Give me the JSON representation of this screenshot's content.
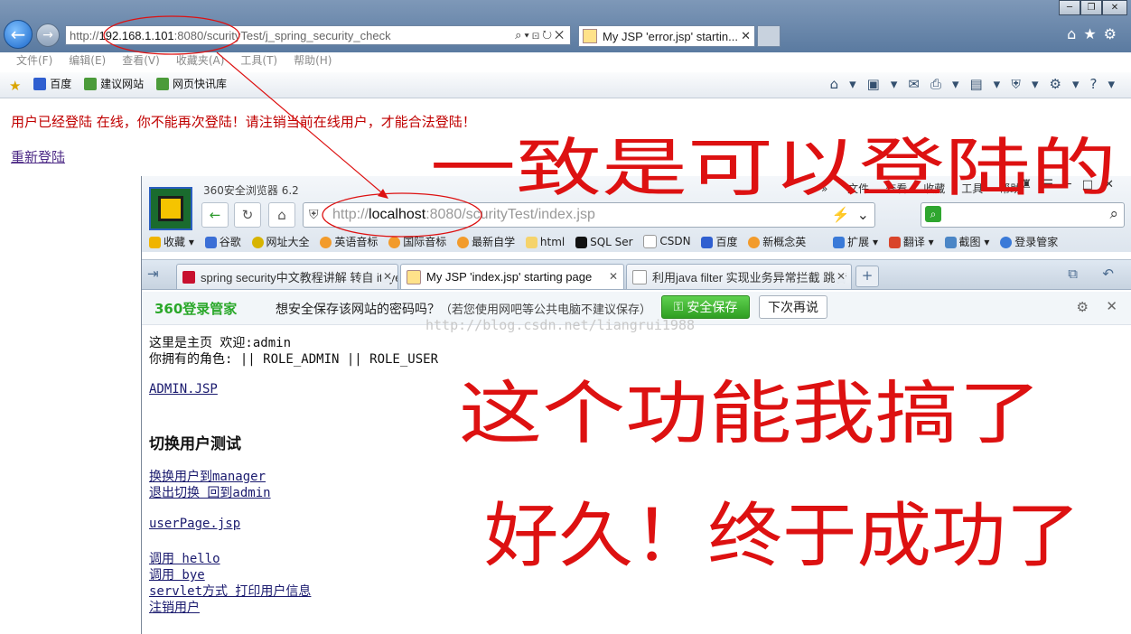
{
  "ie": {
    "address": {
      "prefix": "http://",
      "host": "192.168.1.101",
      "rest": ":8080/scurityTest/j_spring_security_check"
    },
    "tab_title": "My JSP 'error.jsp' startin...",
    "menu": [
      "文件(F)",
      "编辑(E)",
      "查看(V)",
      "收藏夹(A)",
      "工具(T)",
      "帮助(H)"
    ],
    "favorites": [
      "百度",
      "建议网站",
      "网页快讯库"
    ],
    "error_message": "用户已经登陆 在线，你不能再次登陆！请注销当前在线用户，才能合法登陆！",
    "relogin_link": "重新登陆"
  },
  "w360": {
    "app_name": "360安全浏览器 6.2",
    "menu": [
      "文件",
      "查看",
      "收藏",
      "工具",
      "帮助"
    ],
    "address": {
      "prefix": "http://",
      "host": "localhost",
      "rest": ":8080/scurityTest/index.jsp"
    },
    "bookmarks": [
      "收藏",
      "谷歌",
      "网址大全",
      "英语音标",
      "国际音标",
      "最新自学",
      "html",
      "SQL Ser",
      "CSDN",
      "百度",
      "新概念英"
    ],
    "tools": [
      "扩展",
      "翻译",
      "截图",
      "登录管家"
    ],
    "tabs": [
      {
        "title": "spring security中文教程讲解 转自 iteye"
      },
      {
        "title": "My JSP 'index.jsp' starting page"
      },
      {
        "title": "利用java filter 实现业务异常拦截 跳转"
      }
    ],
    "pwbar": {
      "brand": "360登录管家",
      "question": "想安全保存该网站的密码吗？",
      "hint": "（若您使用网吧等公共电脑不建议保存）",
      "save": "安全保存",
      "later": "下次再说"
    }
  },
  "watermark": "http://blog.csdn.net/liangrui1988",
  "page": {
    "welcome": "这里是主页 欢迎:admin",
    "roles": "你拥有的角色: || ROLE_ADMIN || ROLE_USER",
    "admin_link": "ADMIN.JSP",
    "heading": "切换用户测试",
    "switch_to_manager": "换换用户到manager",
    "exit_switch": "退出切换 回到admin",
    "userpage": "userPage.jsp",
    "call_hello": "调用 hello",
    "call_bye": "调用 bye",
    "servlet_print": "servlet方式 打印用户信息",
    "logout": "注销用户"
  },
  "annotations": {
    "top": "一致是可以登陆的",
    "middle": "这个功能我搞了",
    "bottom": "好久！终于成功了"
  },
  "colors": {
    "annotation_red": "#dd1111",
    "error_red": "#c00000",
    "link": "#1a1a6e",
    "save_green": "#3fae2e"
  }
}
